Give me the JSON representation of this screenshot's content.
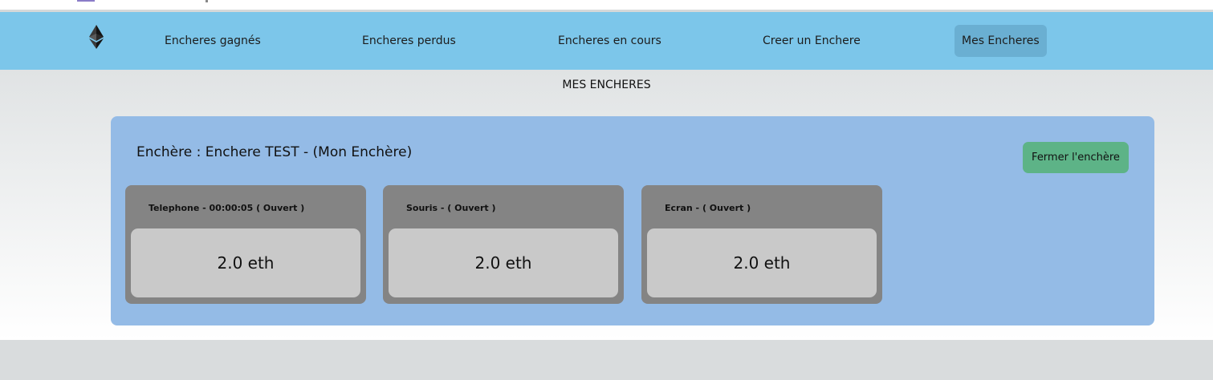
{
  "navbar": {
    "logo_icon": "ethereum-icon",
    "items": [
      {
        "label": "Encheres gagnés"
      },
      {
        "label": "Encheres perdus"
      },
      {
        "label": "Encheres en cours"
      },
      {
        "label": "Creer un Enchere"
      },
      {
        "label": "Mes Encheres"
      }
    ],
    "active_item": "Mes Encheres",
    "bg_color": "#7cc6ea"
  },
  "main": {
    "page_title": "MES ENCHERES",
    "auction": {
      "title": "Enchère : Enchere TEST - (Mon Enchère)",
      "close_button_label": "Fermer l'enchère",
      "items": [
        {
          "title": "Telephone - 00:00:05 ( Ouvert )",
          "price": "2.0 eth"
        },
        {
          "title": "Souris - ( Ouvert )",
          "price": "2.0 eth"
        },
        {
          "title": "Ecran - ( Ouvert )",
          "price": "2.0 eth"
        }
      ]
    }
  }
}
